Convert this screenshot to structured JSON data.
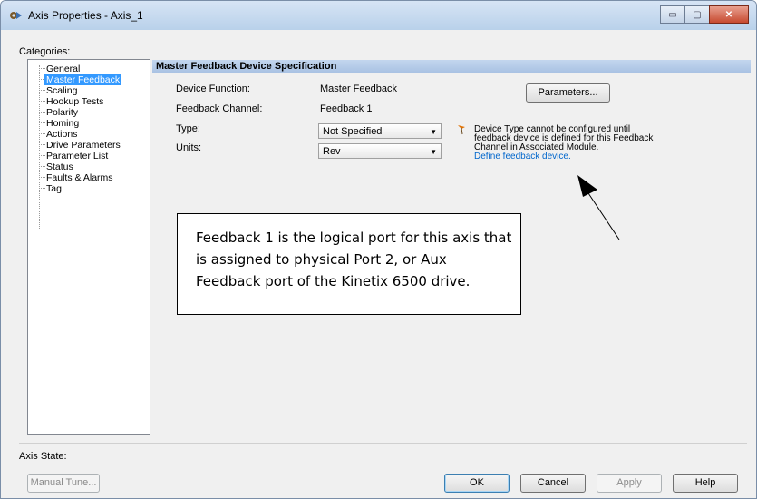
{
  "window": {
    "title": "Axis Properties - Axis_1",
    "buttons": {
      "minimize": "▭",
      "maximize": "▢",
      "close": "✕"
    }
  },
  "sidebar": {
    "label": "Categories:",
    "items": [
      {
        "label": "General",
        "selected": false
      },
      {
        "label": "Master Feedback",
        "selected": true
      },
      {
        "label": "Scaling",
        "selected": false
      },
      {
        "label": "Hookup Tests",
        "selected": false
      },
      {
        "label": "Polarity",
        "selected": false
      },
      {
        "label": "Homing",
        "selected": false
      },
      {
        "label": "Actions",
        "selected": false
      },
      {
        "label": "Drive Parameters",
        "selected": false
      },
      {
        "label": "Parameter List",
        "selected": false
      },
      {
        "label": "Status",
        "selected": false
      },
      {
        "label": "Faults & Alarms",
        "selected": false
      },
      {
        "label": "Tag",
        "selected": false
      }
    ]
  },
  "main": {
    "header": "Master Feedback Device Specification",
    "device_function_label": "Device Function:",
    "device_function_value": "Master Feedback",
    "feedback_channel_label": "Feedback Channel:",
    "feedback_channel_value": "Feedback 1",
    "type_label": "Type:",
    "type_value": "Not Specified",
    "units_label": "Units:",
    "units_value": "Rev",
    "parameters_button": "Parameters...",
    "note_line1": "Device Type cannot be configured until",
    "note_line2": "feedback device is defined for this Feedback",
    "note_line3": "Channel in Associated Module.",
    "note_link": "Define feedback device.",
    "callout": "Feedback 1 is the logical port for this axis that is assigned to physical Port 2, or Aux Feedback port of the Kinetix 6500 drive."
  },
  "footer": {
    "axis_state_label": "Axis State:",
    "manual_tune": "Manual Tune...",
    "ok": "OK",
    "cancel": "Cancel",
    "apply": "Apply",
    "help": "Help"
  },
  "icons": {
    "app": "axis-gear-icon",
    "flag": "warning-flag-icon",
    "dropdown": "chevron-down-icon"
  },
  "colors": {
    "selection": "#3399ff",
    "link": "#0066cc",
    "header_band": "#b7cde9"
  }
}
